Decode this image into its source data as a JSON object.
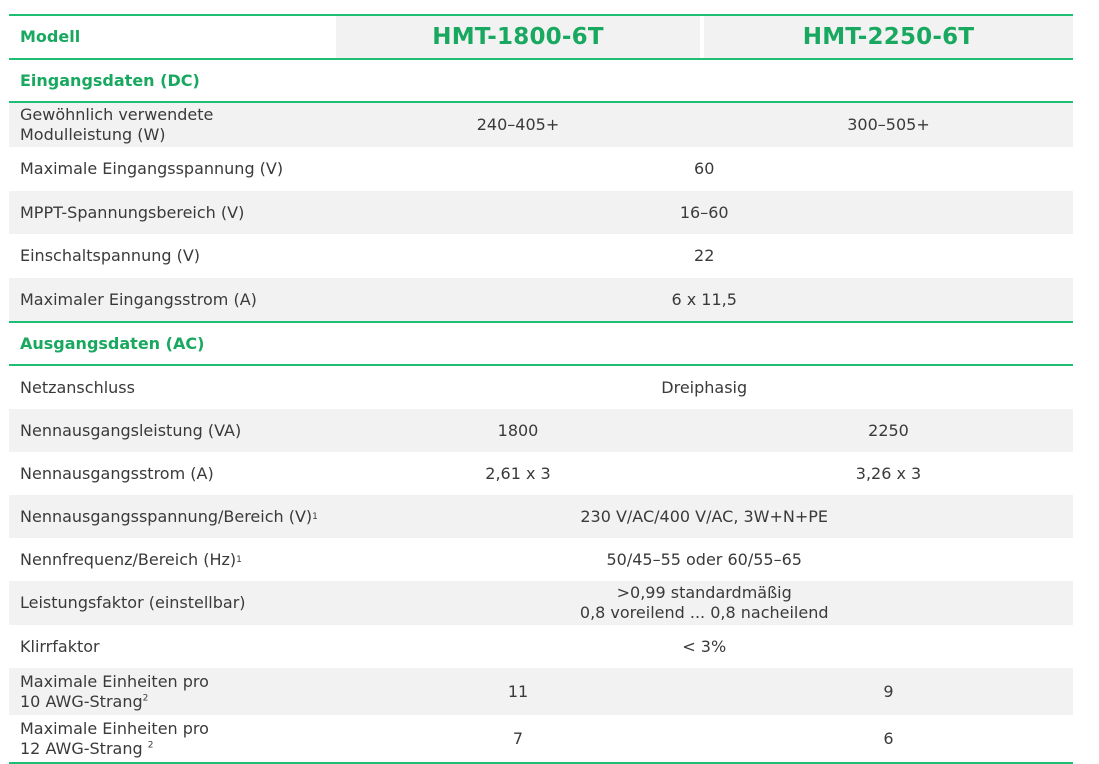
{
  "header": {
    "label": "Modell",
    "model1": "HMT-1800-6T",
    "model2": "HMT-2250-6T"
  },
  "sections": {
    "dc": "Eingangsdaten (DC)",
    "ac": "Ausgangsdaten (AC)"
  },
  "rows": {
    "modulleistung": {
      "label_l1": "Gewöhnlich verwendete",
      "label_l2": "Modulleistung (W)",
      "v1": "240–405+",
      "v2": "300–505+"
    },
    "max_eingangsspannung": {
      "label": "Maximale Eingangsspannung (V)",
      "value": "60"
    },
    "mppt": {
      "label": "MPPT-Spannungsbereich (V)",
      "value": "16–60"
    },
    "einschaltspannung": {
      "label": "Einschaltspannung (V)",
      "value": "22"
    },
    "max_eingangsstrom": {
      "label": "Maximaler Eingangsstrom (A)",
      "value": "6 x 11,5"
    },
    "netzanschluss": {
      "label": "Netzanschluss",
      "value": "Dreiphasig"
    },
    "nennausgangsleistung": {
      "label": "Nennausgangsleistung (VA)",
      "v1": "1800",
      "v2": "2250"
    },
    "nennausgangsstrom": {
      "label": "Nennausgangsstrom (A)",
      "v1": "2,61 x 3",
      "v2": "3,26 x 3"
    },
    "nennausgangsspannung": {
      "label": "Nennausgangsspannung/Bereich (V)",
      "sup": "1",
      "value": "230 V/AC/400 V/AC, 3W+N+PE"
    },
    "nennfrequenz": {
      "label": "Nennfrequenz/Bereich (Hz)",
      "sup": "1",
      "value": "50/45–55 oder 60/55–65"
    },
    "leistungsfaktor": {
      "label": "Leistungsfaktor (einstellbar)",
      "value_l1": ">0,99 standardmäßig",
      "value_l2": "0,8 voreilend ... 0,8 nacheilend"
    },
    "klirrfaktor": {
      "label": "Klirrfaktor",
      "value": "< 3%"
    },
    "einheiten_10awg": {
      "label_l1": "Maximale Einheiten pro",
      "label_l2": "10 AWG-Strang",
      "sup": "2",
      "v1": "11",
      "v2": "9"
    },
    "einheiten_12awg": {
      "label_l1": "Maximale Einheiten pro",
      "label_l2": "12 AWG-Strang ",
      "sup": "2",
      "v1": "7",
      "v2": "6"
    }
  },
  "colors": {
    "accent": "#1fbf73",
    "accent_text": "#19a85f",
    "shade": "#f2f2f2",
    "text": "#3a3a3a"
  }
}
